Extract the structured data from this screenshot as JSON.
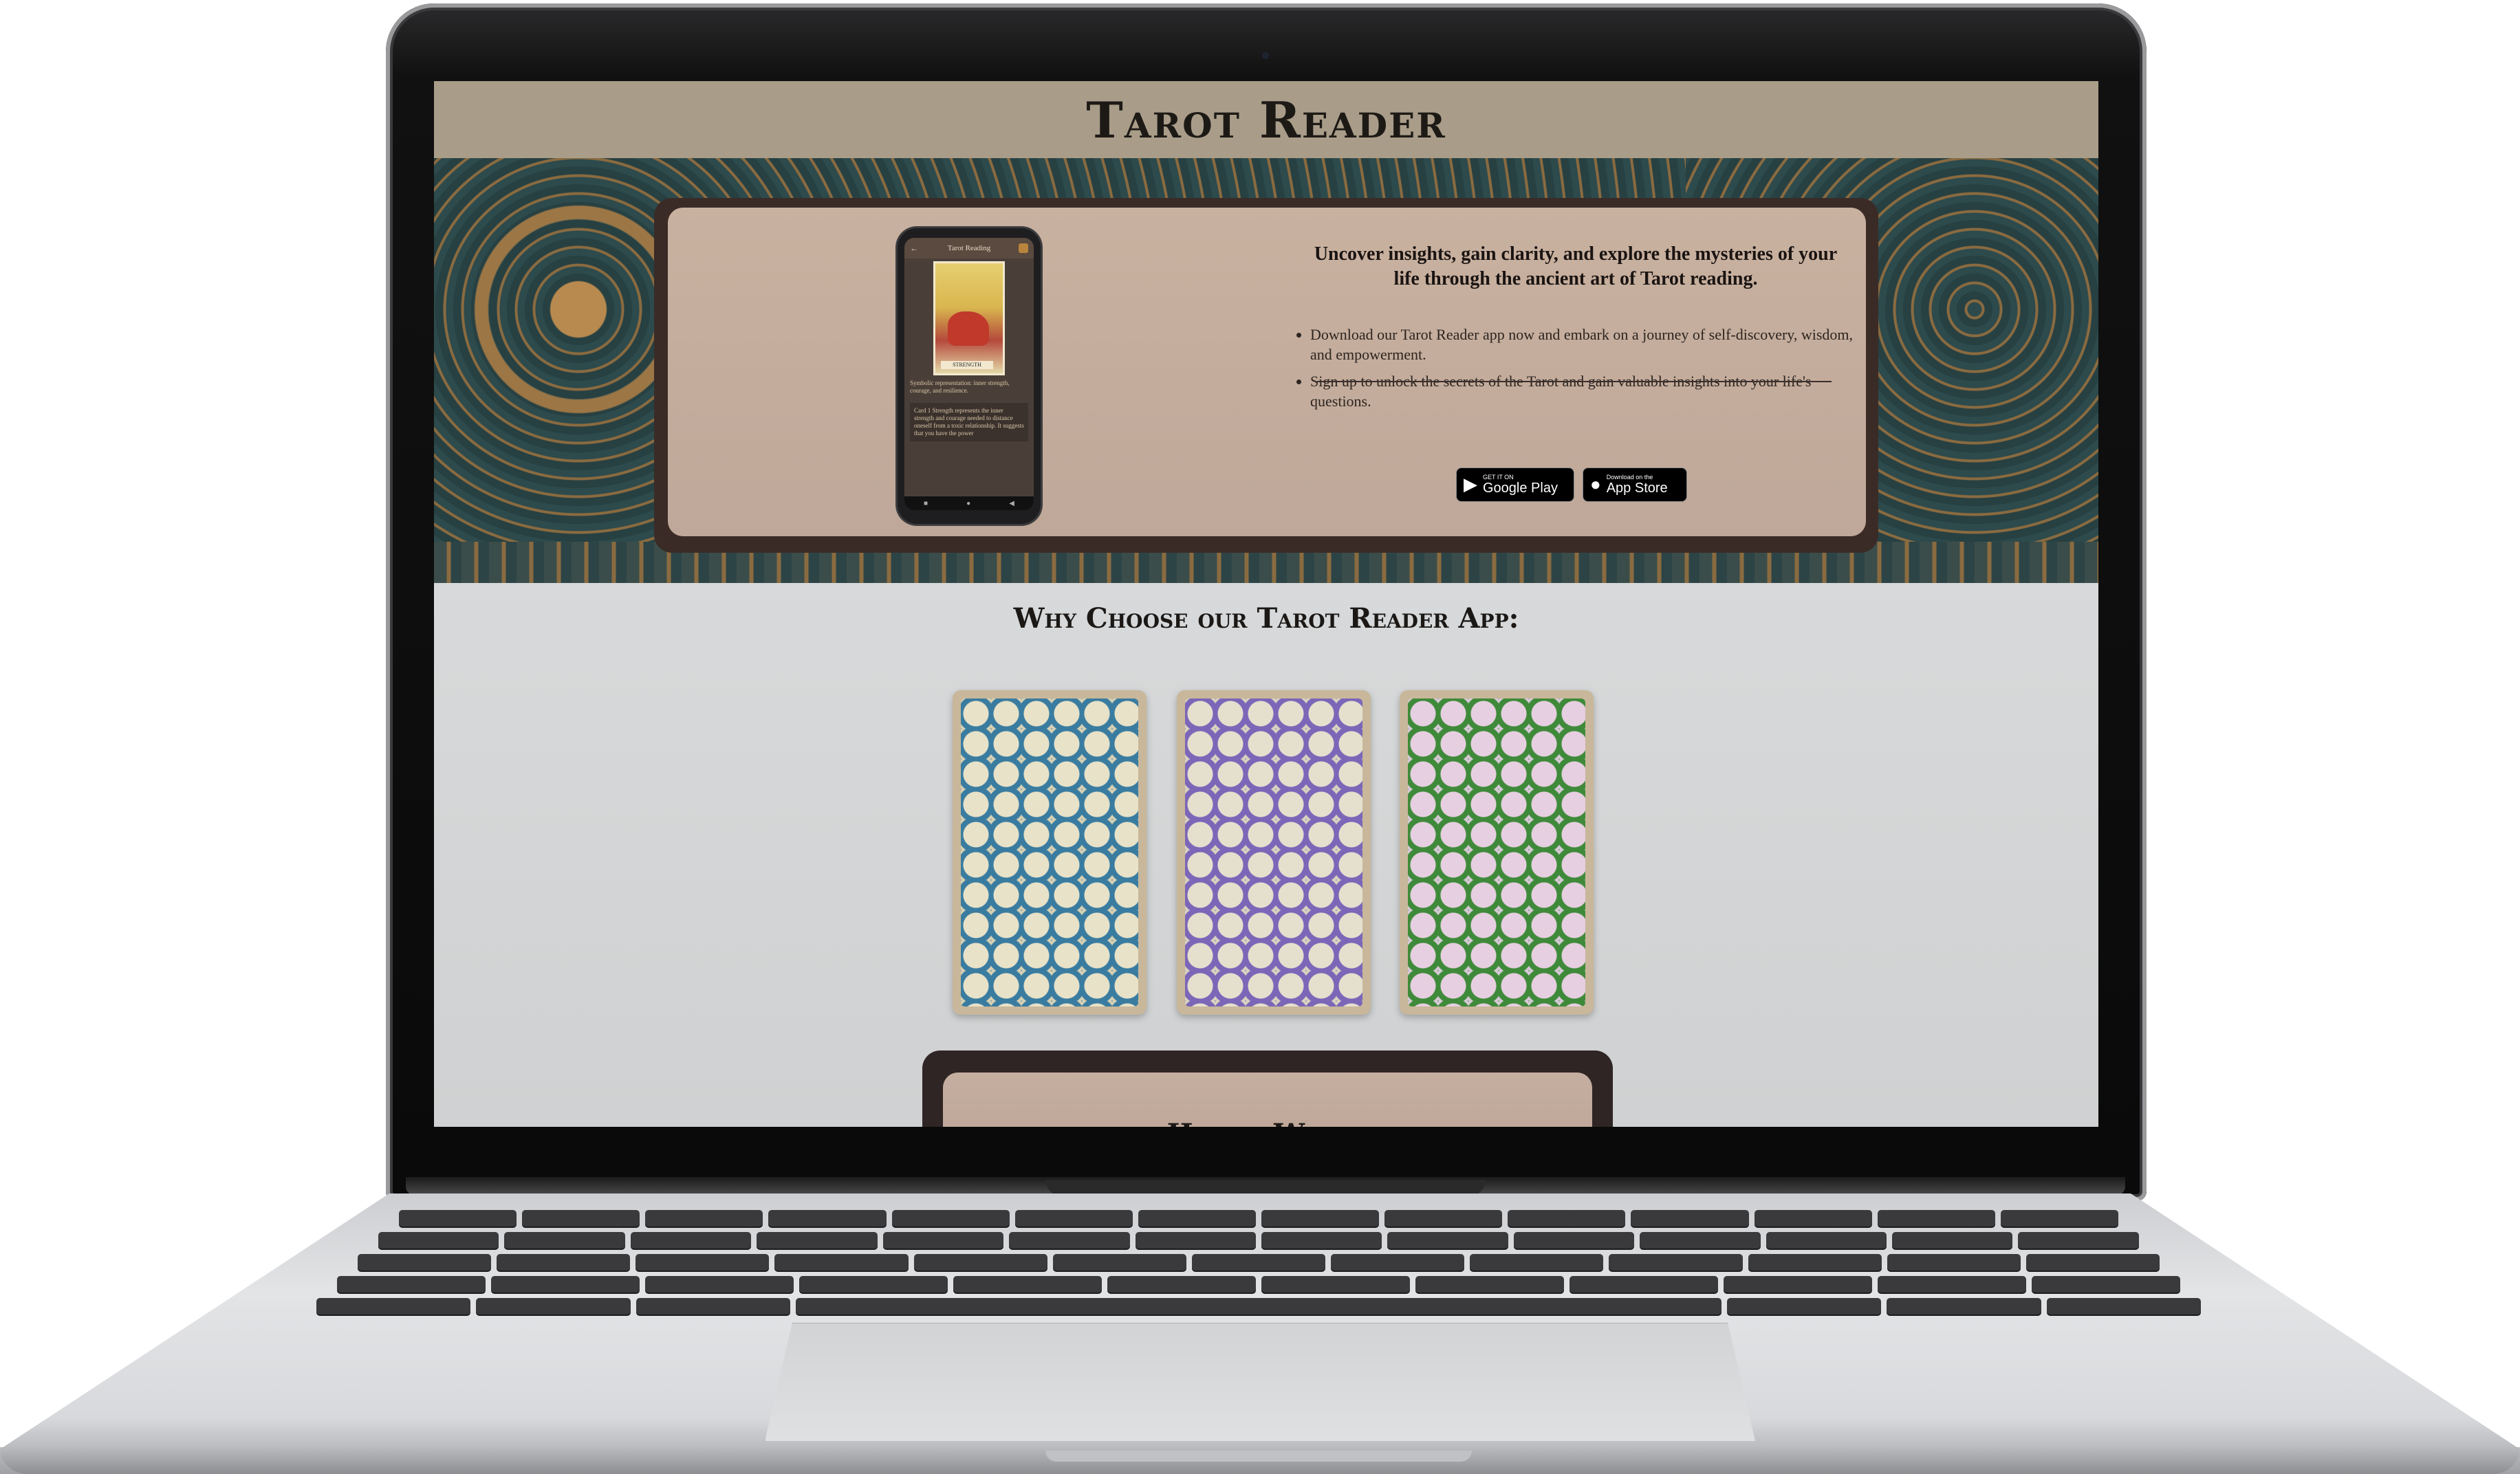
{
  "site": {
    "title": "Tarot Reader"
  },
  "hero": {
    "heading": "Uncover insights, gain clarity, and explore the mysteries of your life through the ancient art of Tarot reading.",
    "bullets": [
      "Download our Tarot Reader app now and embark on a journey of self-discovery, wisdom, and empowerment.",
      "Sign up to unlock the secrets of the Tarot and gain valuable insights into your life's questions."
    ],
    "badges": {
      "google_small": "GET IT ON",
      "google_big": "Google Play",
      "apple_small": "Download on the",
      "apple_big": "App Store"
    }
  },
  "phone": {
    "bar_title": "Tarot Reading",
    "card_label": "STRENGTH",
    "text_1": "Symbolic representation: inner strength, courage, and resilience.",
    "text_2": "Card 1 Strength represents the inner strength and courage needed to distance oneself from a toxic relationship. It suggests that you have the power"
  },
  "why": {
    "title": "Why Choose our Tarot Reader App:",
    "decks": [
      "blue",
      "purple",
      "green"
    ]
  },
  "how": {
    "title": "How it Works"
  },
  "colors": {
    "header_bg": "#a99d89",
    "card_bg": "#c9b1a0",
    "frame_dark": "#3b2b27",
    "section_bg": "#d7d9da"
  }
}
